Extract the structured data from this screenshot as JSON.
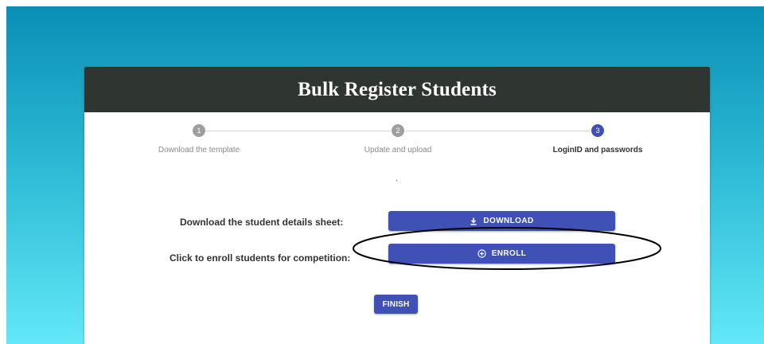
{
  "header": {
    "title": "Bulk Register Students"
  },
  "stepper": {
    "steps": [
      {
        "number": "1",
        "label": "Download the template",
        "state": "completed"
      },
      {
        "number": "2",
        "label": "Update and upload",
        "state": "completed"
      },
      {
        "number": "3",
        "label": "LoginID and passwords",
        "state": "active"
      }
    ]
  },
  "actions": {
    "download_label": "Download the student details sheet:",
    "download_button": "DOWNLOAD",
    "enroll_label": "Click to enroll students for competition:",
    "enroll_button": "ENROLL",
    "finish_button": "FINISH"
  },
  "colors": {
    "primary": "#3f51b5",
    "header_bg": "#2f3632",
    "step_inactive": "#9e9e9e",
    "backdrop_top": "#0a8fb6",
    "backdrop_bottom": "#62e8f7"
  },
  "icons": {
    "download": "download-icon",
    "enroll": "add-circle-outline-icon"
  }
}
